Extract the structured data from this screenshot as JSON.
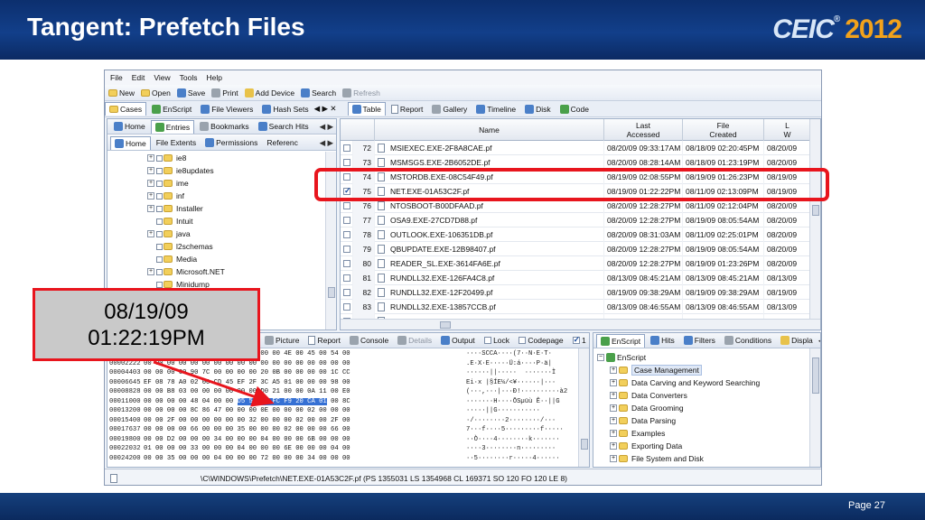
{
  "slide": {
    "title": "Tangent: Prefetch Files",
    "logo_brand": "CEIC",
    "logo_reg": "®",
    "logo_year": "2012",
    "page": "Page 27"
  },
  "callout": {
    "line1": "08/19/09",
    "line2": "01:22:19PM"
  },
  "colors": {
    "header_blue": "#123f8a",
    "accent_red": "#e8151d",
    "logo_orange": "#f2a21b"
  },
  "menu": [
    "File",
    "Edit",
    "View",
    "Tools",
    "Help"
  ],
  "toolbar": {
    "new": "New",
    "open": "Open",
    "save": "Save",
    "print": "Print",
    "add_device": "Add Device",
    "search": "Search",
    "refresh": "Refresh"
  },
  "left_tabs": {
    "cases": "Cases",
    "enscript": "EnScript",
    "file_viewers": "File Viewers",
    "hash_sets": "Hash Sets",
    "more": "◀ ▶ ✕"
  },
  "left_tabs2": {
    "home": "Home",
    "entries": "Entries",
    "bookmarks": "Bookmarks",
    "search_hits": "Search Hits",
    "more": "◀ ▶"
  },
  "left_tabs3": {
    "home": "Home",
    "file_extents": "File Extents",
    "permissions": "Permissions",
    "references": "Referenc",
    "more": "◀ ▶"
  },
  "tree_items": [
    {
      "label": "ie8",
      "exp": "+"
    },
    {
      "label": "ie8updates",
      "exp": "+"
    },
    {
      "label": "ime",
      "exp": "+"
    },
    {
      "label": "inf",
      "exp": "+"
    },
    {
      "label": "Installer",
      "exp": "+"
    },
    {
      "label": "Intuit",
      "exp": ""
    },
    {
      "label": "java",
      "exp": "+"
    },
    {
      "label": "l2schemas",
      "exp": ""
    },
    {
      "label": "Media",
      "exp": ""
    },
    {
      "label": "Microsoft.NET",
      "exp": "+"
    },
    {
      "label": "Minidump",
      "exp": ""
    }
  ],
  "right_tabs": {
    "table": "Table",
    "report": "Report",
    "gallery": "Gallery",
    "timeline": "Timeline",
    "disk": "Disk",
    "code": "Code"
  },
  "table": {
    "headers": {
      "name": "Name",
      "last_accessed": "Last\nAccessed",
      "file_created": "File\nCreated",
      "last_written": "L\nW"
    },
    "rows": [
      {
        "num": "72",
        "name": "MSIEXEC.EXE-2F8A8CAE.pf",
        "accessed": "08/20/09 09:33:17AM",
        "created": "08/18/09 02:20:45PM",
        "written": "08/20/09",
        "checked": false
      },
      {
        "num": "73",
        "name": "MSMSGS.EXE-2B6052DE.pf",
        "accessed": "08/20/09 08:28:14AM",
        "created": "08/18/09 01:23:19PM",
        "written": "08/20/09",
        "checked": false
      },
      {
        "num": "74",
        "name": "MSTORDB.EXE-08C54F49.pf",
        "accessed": "08/19/09 02:08:55PM",
        "created": "08/19/09 01:26:23PM",
        "written": "08/19/09",
        "checked": false
      },
      {
        "num": "75",
        "name": "NET.EXE-01A53C2F.pf",
        "accessed": "08/19/09 01:22:22PM",
        "created": "08/11/09 02:13:09PM",
        "written": "08/19/09",
        "checked": true
      },
      {
        "num": "76",
        "name": "NTOSBOOT-B00DFAAD.pf",
        "accessed": "08/20/09 12:28:27PM",
        "created": "08/11/09 02:12:04PM",
        "written": "08/20/09",
        "checked": false
      },
      {
        "num": "77",
        "name": "OSA9.EXE-27CD7D88.pf",
        "accessed": "08/20/09 12:28:27PM",
        "created": "08/19/09 08:05:54AM",
        "written": "08/20/09",
        "checked": false
      },
      {
        "num": "78",
        "name": "OUTLOOK.EXE-106351DB.pf",
        "accessed": "08/20/09 08:31:03AM",
        "created": "08/11/09 02:25:01PM",
        "written": "08/20/09",
        "checked": false
      },
      {
        "num": "79",
        "name": "QBUPDATE.EXE-12B98407.pf",
        "accessed": "08/20/09 12:28:27PM",
        "created": "08/19/09 08:05:54AM",
        "written": "08/20/09",
        "checked": false
      },
      {
        "num": "80",
        "name": "READER_SL.EXE-3614FA6E.pf",
        "accessed": "08/20/09 12:28:27PM",
        "created": "08/19/09 01:23:26PM",
        "written": "08/20/09",
        "checked": false
      },
      {
        "num": "81",
        "name": "RUNDLL32.EXE-126FA4C8.pf",
        "accessed": "08/13/09 08:45:21AM",
        "created": "08/13/09 08:45:21AM",
        "written": "08/13/09",
        "checked": false
      },
      {
        "num": "82",
        "name": "RUNDLL32.EXE-12F20499.pf",
        "accessed": "08/19/09 09:38:29AM",
        "created": "08/19/09 09:38:29AM",
        "written": "08/19/09",
        "checked": false
      },
      {
        "num": "83",
        "name": "RUNDLL32.EXE-13857CCB.pf",
        "accessed": "08/13/09 08:46:55AM",
        "created": "08/13/09 08:46:55AM",
        "written": "08/13/09",
        "checked": false
      },
      {
        "num": "84",
        "name": "RUNDLL32.EXE-15565835.pf",
        "accessed": "08/13/09 08:46:56AM",
        "created": "08/13/09 08:46:56AM",
        "written": "08/13/09",
        "checked": false
      }
    ]
  },
  "hex_tabs": {
    "picture": "Picture",
    "report": "Report",
    "console": "Console",
    "details": "Details",
    "output": "Output",
    "lock": "Lock",
    "codepage": "Codepage",
    "count": "1",
    "more": "◀ ▶"
  },
  "hex": {
    "offsets": [
      "00000000",
      "00002222",
      "00004403",
      "00006645",
      "00008828",
      "00011000",
      "00013200",
      "00015400",
      "00017637",
      "00019800",
      "00022032",
      "00024200"
    ],
    "bytes": [
      "FF 00 00 00 00 00 00 00 28 37 00 00 4E 00 45 00 54 00",
      "00 00 00 00 00 00 00 00 00 00 00 00 00 00 00 00 00 00",
      "00 00 00 00 90 7C 00 00 00 00 20 0B 00 00 00 00 1C CC",
      "EF 08 78 A0 02 00 CD 45 EF 2F 3C A5 01 00 00 00 98 00",
      "00 00 B8 03 00 00 00 00 00 00 D0 21 00 00 0A 11 00 E0",
      "00 00 00 00 48 04 00 00 D5 53 B5 FC F9 20 CA 01 00 8C",
      "00 00 00 00 8C 86 47 00 00 00 0E 00 00 00 02 00 00 00",
      "00 00 2F 00 00 00 00 00 00 32 00 00 00 02 00 00 2F 00",
      "00 00 00 00 66 00 00 00 35 00 00 00 02 00 00 00 66 00",
      "00 00 D2 00 00 00 34 00 00 00 04 00 00 00 6B 00 00 00",
      "01 00 00 00 33 00 00 00 04 00 00 00 6E 00 00 00 04 00",
      "00 00 35 00 00 00 04 00 00 00 72 00 00 00 34 00 00 00"
    ],
    "ascii": [
      "····SCCA····(7··N·E·T·",
      ".E·X·E·····Ü:á····P·ä|",
      "······||·····  ·······Ì",
      "Ei·x |§ÍE¼/<¥······|···",
      "(···,···|···Ð!··········à2",
      "·······H····ÕSµüù Ê··||G",
      "·····||G···········",
      "·/········2········/···",
      "7···f····5·········f·····",
      "··Ò····4········k·······",
      "····3········n·········",
      "··5········r·····4······"
    ],
    "selected_bytes": "D5 53 B5 FC F9 20 CA 01"
  },
  "script_tabs": {
    "enscript": "EnScript",
    "hits": "Hits",
    "filters": "Filters",
    "conditions": "Conditions",
    "display": "Displa",
    "more": "◀ ▶"
  },
  "enscript_tree": {
    "root": "EnScript",
    "items": [
      "Case Management",
      "Data Carving and Keyword Searching",
      "Data Converters",
      "Data Grooming",
      "Data Parsing",
      "Examples",
      "Exporting Data",
      "File System and Disk"
    ]
  },
  "status": {
    "path": "\\C\\WINDOWS\\Prefetch\\NET.EXE-01A53C2F.pf (PS 1355031 LS 1354968 CL 169371 SO 120 FO 120 LE 8)"
  }
}
